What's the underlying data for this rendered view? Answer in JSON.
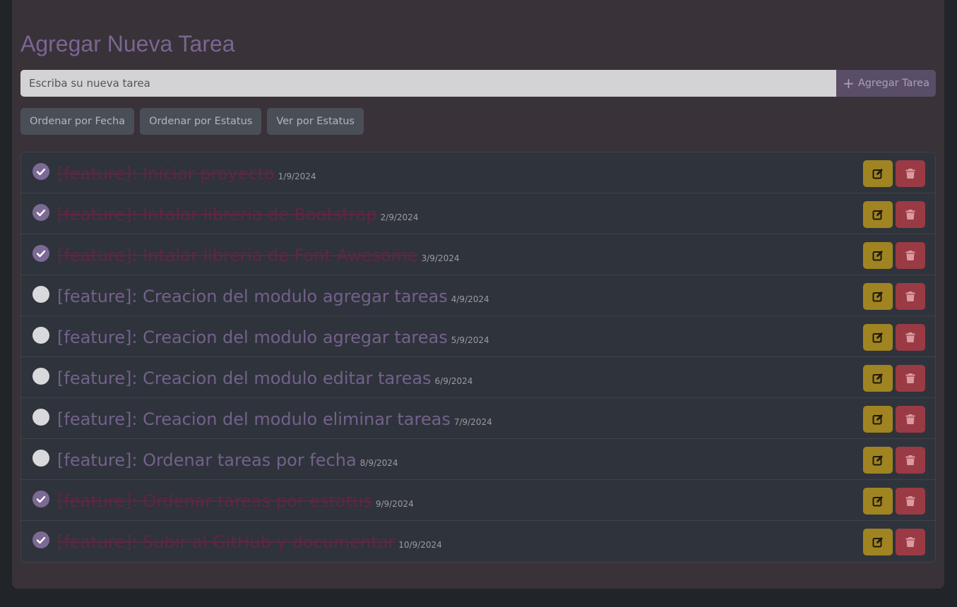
{
  "header": {
    "title": "Agregar Nueva Tarea"
  },
  "form": {
    "input_placeholder": "Escriba su nueva tarea",
    "input_value": "",
    "add_label": "Agregar Tarea",
    "add_icon": "plus-icon"
  },
  "sort": {
    "by_date": "Ordenar por Fecha",
    "by_status": "Ordenar por Estatus",
    "view_status": "Ver por Estatus"
  },
  "icons": {
    "check": "check-icon",
    "edit": "edit-icon",
    "delete": "trash-icon"
  },
  "colors": {
    "accent": "#7c6a95",
    "title": "#7a6593",
    "done_text": "#5c2840",
    "edit": "#a08422",
    "delete": "#9a3a44"
  },
  "tasks": [
    {
      "text": "[feature]: Iniciar proyecto",
      "date": "1/9/2024",
      "done": true
    },
    {
      "text": "[feature]: Intalar libreria de Bootstrap",
      "date": "2/9/2024",
      "done": true
    },
    {
      "text": "[feature]: Intalar libreria de Font Awesome",
      "date": "3/9/2024",
      "done": true
    },
    {
      "text": "[feature]: Creacion del modulo agregar tareas",
      "date": "4/9/2024",
      "done": false
    },
    {
      "text": "[feature]: Creacion del modulo agregar tareas",
      "date": "5/9/2024",
      "done": false
    },
    {
      "text": "[feature]: Creacion del modulo editar tareas",
      "date": "6/9/2024",
      "done": false
    },
    {
      "text": "[feature]: Creacion del modulo eliminar tareas",
      "date": "7/9/2024",
      "done": false
    },
    {
      "text": "[feature]: Ordenar tareas por fecha",
      "date": "8/9/2024",
      "done": false
    },
    {
      "text": "[feature]: Ordenar tareas por estatus",
      "date": "9/9/2024",
      "done": true
    },
    {
      "text": "[feature]: Subir al GitHub y documentar",
      "date": "10/9/2024",
      "done": true
    }
  ]
}
